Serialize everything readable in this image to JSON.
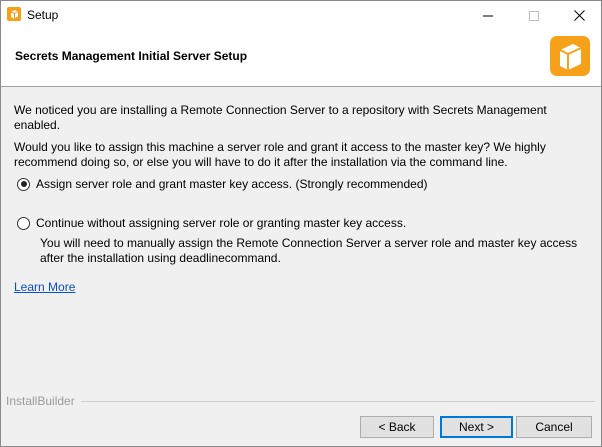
{
  "window": {
    "title": "Setup",
    "icon": "orange-cube-icon"
  },
  "header": {
    "title": "Secrets Management Initial Server Setup",
    "logo": "orange-cube-logo",
    "accent_color": "#f7a11a"
  },
  "main": {
    "notice": "We noticed you are installing a Remote Connection Server to a repository with Secrets Management enabled.",
    "question": "Would you like to assign this machine a server role and grant it access to the master key? We highly recommend doing so, or else you will have to do it after the installation via the command line.",
    "options": [
      {
        "label": "Assign server role and grant master key access. (Strongly recommended)",
        "selected": true
      },
      {
        "label": "Continue without assigning server role or granting master key access.",
        "selected": false
      }
    ],
    "option2_note": "You will need to manually assign the Remote Connection Server a server role and master key access after the installation using deadlinecommand.",
    "learn_more": "Learn More"
  },
  "footer": {
    "brand": "InstallBuilder",
    "back_label": "< Back",
    "next_label": "Next >",
    "cancel_label": "Cancel"
  }
}
